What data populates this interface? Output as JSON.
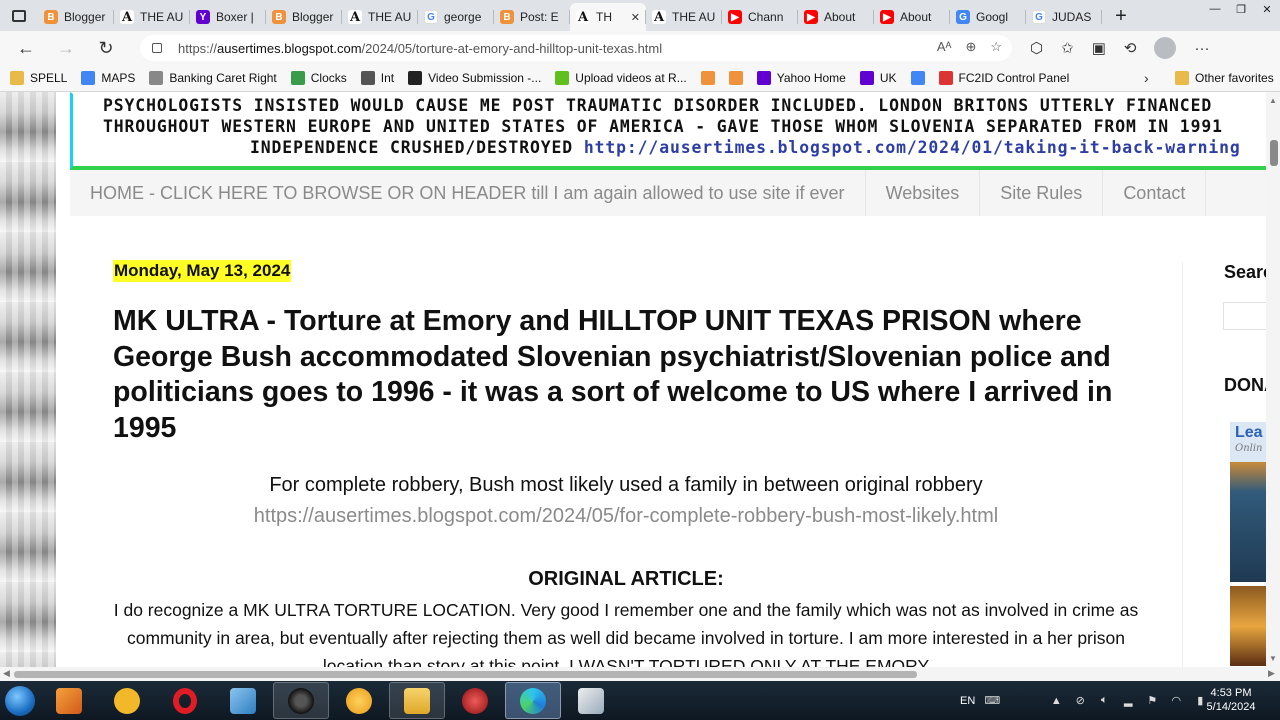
{
  "tabs": [
    {
      "label": "Blogger",
      "icon": "blogger-icon",
      "fav": "B",
      "cls": "fav-blogger"
    },
    {
      "label": "THE AU",
      "icon": "a-logo-icon",
      "fav": "A",
      "cls": "fav-a"
    },
    {
      "label": "Boxer |",
      "icon": "yahoo-icon",
      "fav": "Y",
      "cls": "fav-yahoo"
    },
    {
      "label": "Blogger",
      "icon": "blogger-icon",
      "fav": "B",
      "cls": "fav-blogger"
    },
    {
      "label": "THE AU",
      "icon": "a-logo-icon",
      "fav": "A",
      "cls": "fav-a"
    },
    {
      "label": "george",
      "icon": "google-icon",
      "fav": "G",
      "cls": "fav-google"
    },
    {
      "label": "Post: E",
      "icon": "blogger-icon",
      "fav": "B",
      "cls": "fav-blogger"
    },
    {
      "label": "TH",
      "icon": "a-logo-icon",
      "fav": "A",
      "cls": "fav-a",
      "active": true
    },
    {
      "label": "THE AU",
      "icon": "a-logo-icon",
      "fav": "A",
      "cls": "fav-a"
    },
    {
      "label": "Chann",
      "icon": "youtube-icon",
      "fav": "▶",
      "cls": "fav-yt"
    },
    {
      "label": "About",
      "icon": "youtube-icon",
      "fav": "▶",
      "cls": "fav-yt"
    },
    {
      "label": "About",
      "icon": "youtube-icon",
      "fav": "▶",
      "cls": "fav-yt"
    },
    {
      "label": "Googl",
      "icon": "google-translate-icon",
      "fav": "G",
      "cls": "fav-gtrans"
    },
    {
      "label": "JUDAS",
      "icon": "google-icon",
      "fav": "G",
      "cls": "fav-google"
    }
  ],
  "address": {
    "url_prefix": "https://",
    "url_host": "ausertimes.blogspot.com",
    "url_path": "/2024/05/torture-at-emory-and-hilltop-unit-texas.html"
  },
  "favorites": [
    {
      "label": "SPELL",
      "icon": "folder-icon"
    },
    {
      "label": "MAPS",
      "icon": "google-icon"
    },
    {
      "label": "Banking Caret Right",
      "icon": "page-icon"
    },
    {
      "label": "Clocks",
      "icon": "clock-icon"
    },
    {
      "label": "Int",
      "icon": "calculator-icon"
    },
    {
      "label": "Video Submission -...",
      "icon": "video-icon"
    },
    {
      "label": "Upload videos at R...",
      "icon": "rumble-icon"
    },
    {
      "label": "",
      "icon": "blogger-icon"
    },
    {
      "label": "",
      "icon": "blogger-icon"
    },
    {
      "label": "Yahoo Home",
      "icon": "yahoo-icon"
    },
    {
      "label": "UK",
      "icon": "yahoo-icon"
    },
    {
      "label": "",
      "icon": "translate-icon"
    },
    {
      "label": "FC2ID Control Panel",
      "icon": "fc2-icon"
    }
  ],
  "favorites_other": "Other favorites",
  "banner": {
    "line1": "PSYCHOLOGISTS INSISTED WOULD CAUSE ME POST TRAUMATIC DISORDER INCLUDED. LONDON BRITONS UTTERLY FINANCED",
    "line2": "THROUGHOUT WESTERN EUROPE AND UNITED STATES OF AMERICA - GAVE THOSE WHOM SLOVENIA SEPARATED FROM IN 1991",
    "line3": "INDEPENDENCE CRUSHED/DESTROYED",
    "line3_link": "http://ausertimes.blogspot.com/2024/01/taking-it-back-warning"
  },
  "menu": [
    "HOME - CLICK HERE TO BROWSE OR ON HEADER till I am again allowed to use site if ever",
    "Websites",
    "Site Rules",
    "Contact"
  ],
  "post": {
    "date": "Monday, May 13, 2024",
    "title": "MK ULTRA - Torture at Emory and HILLTOP UNIT TEXAS PRISON where George Bush accommodated Slovenian psychiatrist/Slovenian police and politicians goes to 1996 - it was a sort of welcome to US where I arrived in 1995",
    "intro": "For complete robbery, Bush most likely used a family in between original robbery",
    "intro_link": "https://ausertimes.blogspot.com/2024/05/for-complete-robbery-bush-most-likely.html",
    "original_heading": "ORIGINAL ARTICLE:",
    "body": "I do recognize a MK ULTRA TORTURE LOCATION. Very good I remember one and the family which was not as involved in crime as community in area, but eventually after rejecting them as well did became involved in torture. I am more interested in a her prison location than story at this point. I WASN'T TORTURED ONLY AT THE EMORY"
  },
  "sidebar": {
    "search_heading": "Search",
    "donate_heading": "DONATE",
    "ad_title": "Lea",
    "ad_sub": "Onlin"
  },
  "taskbar": {
    "lang": "EN",
    "time": "4:53 PM",
    "date": "5/14/2024"
  }
}
